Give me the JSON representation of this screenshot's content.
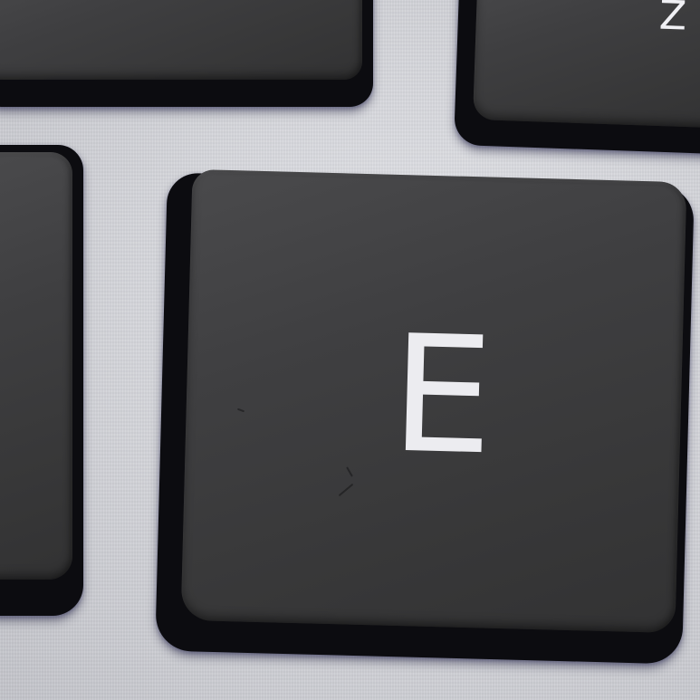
{
  "scene": {
    "description_keys": {
      "main_key": {
        "legend": "E"
      },
      "top_right_key": {
        "legend": "Z"
      }
    },
    "colors": {
      "keycap": "#3d3d3f",
      "chassis": "#d8d9de",
      "legend": "#ececf0"
    }
  }
}
